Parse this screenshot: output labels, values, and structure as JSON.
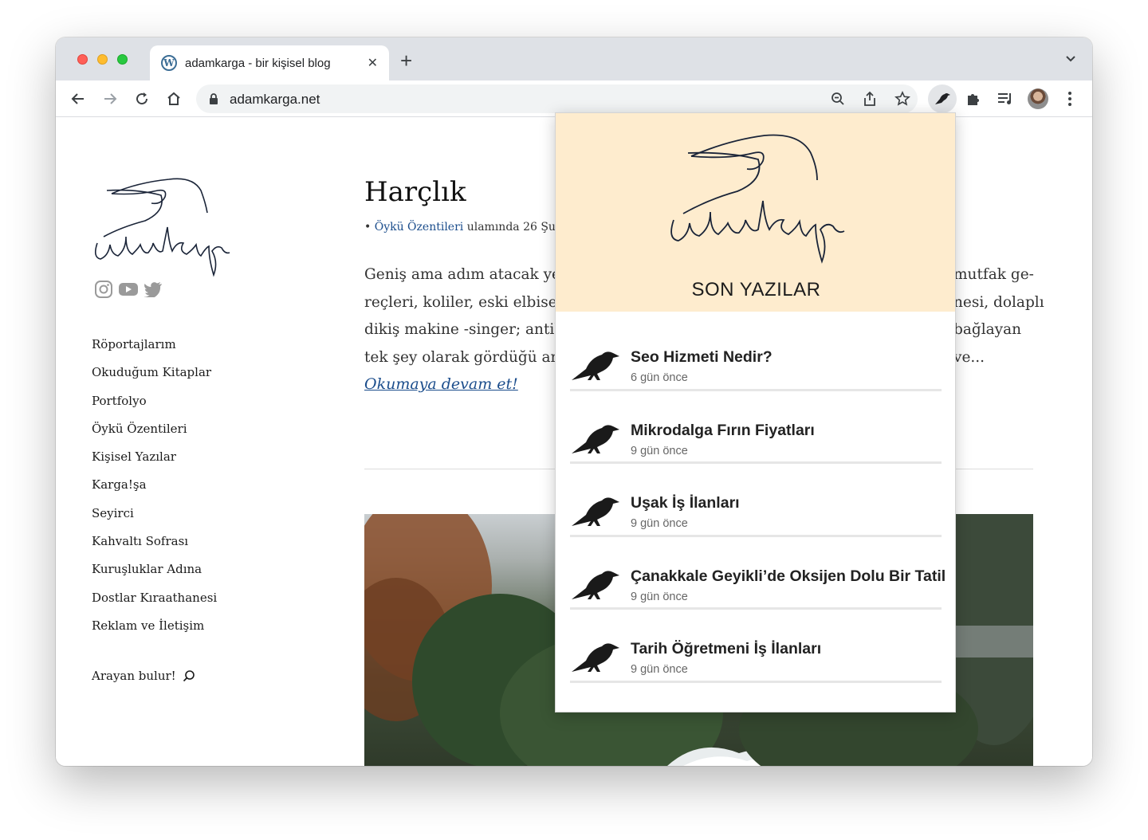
{
  "browser": {
    "tab_title": "adamkarga - bir kişisel blog",
    "url": "adamkarga.net"
  },
  "sidebar": {
    "logo_text": "adamkarga",
    "social": [
      "instagram-icon",
      "youtube-icon",
      "twitter-icon"
    ],
    "nav": [
      "Röportajlarım",
      "Okuduğum Kitaplar",
      "Portfolyo",
      "Öykü Özentileri",
      "Kişisel Yazılar",
      "Karga!şa",
      "Seyirci",
      "Kahvaltı Sofrası",
      "Kuruşluklar Adına",
      "Dostlar Kıraathanesi",
      "Reklam ve İletişim"
    ],
    "search_label": "Arayan bulur!"
  },
  "post": {
    "title": "Harçlık",
    "meta_bullet": "•",
    "category": "Öykü Özentileri",
    "meta_rest": "ulamında 26 Şu",
    "excerpt_lines": [
      "Geniş ama adım atacak yer",
      "reçleri, koliler, eski elbisele",
      "dikiş makine -singer; antika",
      "tek şey olarak gördüğü ann"
    ],
    "excerpt_right": [
      "mutfak ge-",
      "nesi, dolaplı",
      "bağlayan",
      "ve..."
    ],
    "read_more": "Okumaya devam et!"
  },
  "popup": {
    "logo_text": "adamkarga",
    "heading": "SON YAZILAR",
    "items": [
      {
        "title": "Seo Hizmeti Nedir?",
        "date": "6 gün önce"
      },
      {
        "title": "Mikrodalga Fırın Fiyatları",
        "date": "9 gün önce"
      },
      {
        "title": "Uşak İş İlanları",
        "date": "9 gün önce"
      },
      {
        "title": "Çanakkale Geyikli’de Oksijen Dolu Bir Tatil",
        "date": "9 gün önce"
      },
      {
        "title": "Tarih Öğretmeni İş İlanları",
        "date": "9 gün önce"
      }
    ]
  },
  "colors": {
    "popup_header_bg": "#feecce",
    "link": "#1b4d8c",
    "tabstrip": "#dee1e6"
  }
}
